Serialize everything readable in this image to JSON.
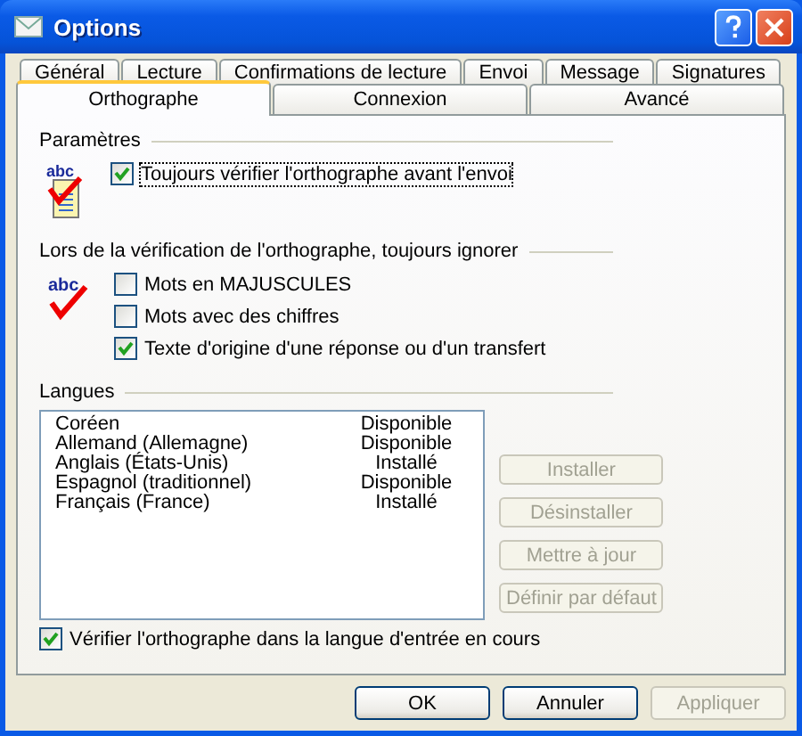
{
  "window": {
    "title": "Options"
  },
  "tab_rows": [
    [
      {
        "label": "Général",
        "selected": false
      },
      {
        "label": "Lecture",
        "selected": false
      },
      {
        "label": "Confirmations de lecture",
        "selected": false
      },
      {
        "label": "Envoi",
        "selected": false
      },
      {
        "label": "Message",
        "selected": false
      },
      {
        "label": "Signatures",
        "selected": false
      }
    ],
    [
      {
        "label": "Orthographe",
        "selected": true
      },
      {
        "label": "Connexion",
        "selected": false
      },
      {
        "label": "Avancé",
        "selected": false
      }
    ]
  ],
  "settings": {
    "label": "Paramètres",
    "icon_text": "abc",
    "options": [
      {
        "label": "Toujours vérifier l'orthographe avant l'envoi",
        "checked": true
      }
    ]
  },
  "ignore": {
    "label": "Lors de la vérification de l'orthographe, toujours ignorer",
    "icon_text": "abc",
    "options": [
      {
        "label": "Mots en MAJUSCULES",
        "checked": false
      },
      {
        "label": "Mots avec des chiffres",
        "checked": false
      },
      {
        "label": "Texte d'origine d'une réponse ou d'un transfert",
        "checked": true
      }
    ]
  },
  "languages": {
    "label": "Langues",
    "rows": [
      {
        "name": "Coréen",
        "status": "Disponible"
      },
      {
        "name": "Allemand (Allemagne)",
        "status": "Disponible"
      },
      {
        "name": "Anglais (États-Unis)",
        "status": "Installé"
      },
      {
        "name": "Espagnol (traditionnel)",
        "status": "Disponible"
      },
      {
        "name": "Français (France)",
        "status": "Installé"
      }
    ],
    "buttons": [
      {
        "label": "Installer",
        "disabled": true
      },
      {
        "label": "Désinstaller",
        "disabled": true
      },
      {
        "label": "Mettre à jour",
        "disabled": true
      },
      {
        "label": "Définir par défaut",
        "disabled": true
      }
    ],
    "option": {
      "label": "Vérifier l'orthographe dans la langue d'entrée en cours",
      "checked": true
    }
  },
  "buttons": [
    {
      "label": "OK",
      "disabled": false
    },
    {
      "label": "Annuler",
      "disabled": false
    },
    {
      "label": "Appliquer",
      "disabled": true
    }
  ]
}
